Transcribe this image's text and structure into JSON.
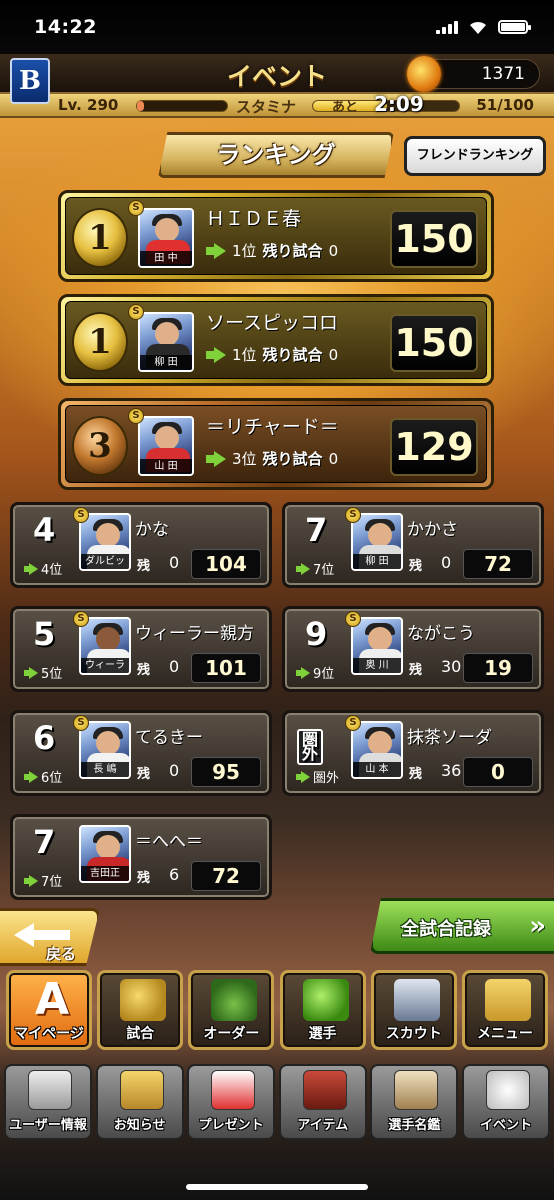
{
  "status": {
    "time": "14:22"
  },
  "header": {
    "logo": "B",
    "title": "イベント",
    "coins": "1371"
  },
  "level": {
    "lv": "Lv. 290",
    "stamina_label": "スタミナ",
    "ato": "あと",
    "recover_time": "2:09",
    "stamina": "51/100",
    "stamina_fraction": 0.51
  },
  "tabs": {
    "ranking": "ランキング",
    "friend": "フレンドランキング"
  },
  "labels": {
    "remain": "残り試合",
    "remain_short": "残"
  },
  "top3": [
    {
      "medal": "1",
      "name": "ＨＩＤＥ春",
      "player": "田 中",
      "rank": "1位",
      "remaining": "0",
      "score": "150"
    },
    {
      "medal": "1",
      "name": "ソースピッコロ",
      "player": "柳 田",
      "rank": "1位",
      "remaining": "0",
      "score": "150"
    },
    {
      "medal": "3",
      "name": "＝リチャード＝",
      "player": "山 田",
      "rank": "3位",
      "remaining": "0",
      "score": "129"
    }
  ],
  "others_left": [
    {
      "num": "4",
      "rank": "4位",
      "name": "かな",
      "player": "ダルビッシュ",
      "remaining": "0",
      "score": "104"
    },
    {
      "num": "5",
      "rank": "5位",
      "name": "ウィーラー親方",
      "player": "ウィーラー",
      "remaining": "0",
      "score": "101"
    },
    {
      "num": "6",
      "rank": "6位",
      "name": "てるきー",
      "player": "長 嶋",
      "remaining": "0",
      "score": "95"
    },
    {
      "num": "7",
      "rank": "7位",
      "name": "＝へへ＝",
      "player": "吉田正",
      "remaining": "6",
      "score": "72"
    }
  ],
  "others_right": [
    {
      "num": "7",
      "rank": "7位",
      "name": "かかさ",
      "player": "柳 田",
      "remaining": "0",
      "score": "72"
    },
    {
      "num": "9",
      "rank": "9位",
      "name": "ながこう",
      "player": "奥 川",
      "remaining": "30",
      "score": "19"
    },
    {
      "num": "圏外",
      "rank": "圏外",
      "name": "抹茶ソーダ",
      "player": "山 本",
      "remaining": "36",
      "score": "0"
    }
  ],
  "buttons": {
    "back": "戻る",
    "record": "全試合記録",
    "record_chevron": "»"
  },
  "main_nav": [
    "マイページ",
    "試合",
    "オーダー",
    "選手",
    "スカウト",
    "メニュー"
  ],
  "sub_nav": [
    "ユーザー情報",
    "お知らせ",
    "プレゼント",
    "アイテム",
    "選手名鑑",
    "イベント"
  ],
  "colors": {
    "gold": "#d7b42e",
    "bronze": "#b96e2a",
    "arrow": "#7fd23a",
    "record_green": "#3e8a16"
  }
}
